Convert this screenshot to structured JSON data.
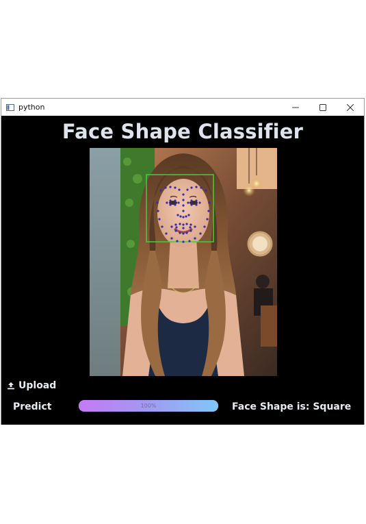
{
  "window": {
    "title": "python"
  },
  "app": {
    "title": "Face Shape Classifier"
  },
  "buttons": {
    "upload_label": "Upload",
    "predict_label": "Predict"
  },
  "progress": {
    "value_percent": 100,
    "label": "100%"
  },
  "result": {
    "text": "Face Shape is: Square"
  },
  "icons": {
    "app": "window-icon",
    "minimize": "minimize-icon",
    "maximize": "maximize-icon",
    "close": "close-icon",
    "upload": "upload-icon"
  },
  "colors": {
    "window_background": "#000000",
    "title_text": "#dfe3ec",
    "face_box": "#3fd03a",
    "landmarks": "#3a2aa8",
    "progress_start": "#c47af4",
    "progress_end": "#7fc7f6"
  }
}
